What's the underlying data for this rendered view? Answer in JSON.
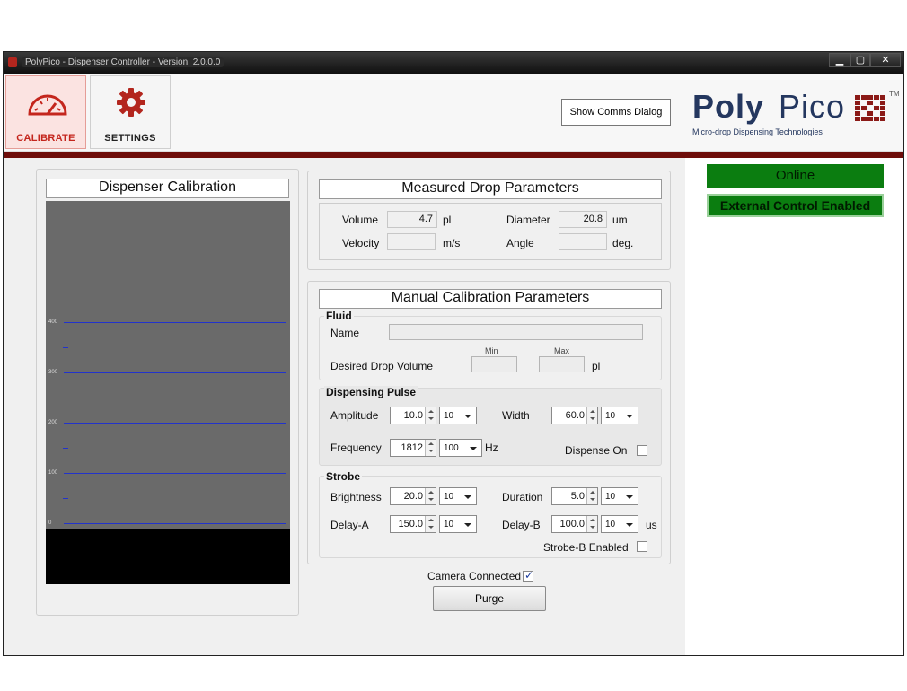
{
  "window": {
    "title": "PolyPico - Dispenser Controller - Version: 2.0.0.0",
    "min": "▁",
    "max": "▢",
    "close": "✕"
  },
  "nav": {
    "calibrate": "CALIBRATE",
    "settings": "SETTINGS",
    "calibrate_icon": "speedometer-icon",
    "settings_icon": "gear-icon"
  },
  "toolbar": {
    "comms_button": "Show Comms Dialog"
  },
  "logo": {
    "poly": "Poly",
    "pico": "Pico",
    "tm": "TM",
    "tagline": "Micro-drop Dispensing Technologies"
  },
  "status": {
    "online": "Online",
    "external": "External Control Enabled",
    "color": "#0b7d10"
  },
  "calibration": {
    "header": "Dispenser Calibration",
    "ticks": [
      "400",
      "300",
      "200",
      "100",
      "0"
    ]
  },
  "measured": {
    "header": "Measured Drop Parameters",
    "volume_label": "Volume",
    "volume_value": "4.7",
    "volume_unit": "pl",
    "diameter_label": "Diameter",
    "diameter_value": "20.8",
    "diameter_unit": "um",
    "velocity_label": "Velocity",
    "velocity_value": "",
    "velocity_unit": "m/s",
    "angle_label": "Angle",
    "angle_value": "",
    "angle_unit": "deg."
  },
  "manual": {
    "header": "Manual Calibration Parameters",
    "fluid": {
      "title": "Fluid",
      "name_label": "Name",
      "name_value": "",
      "desired_label": "Desired Drop Volume",
      "min_label": "Min",
      "max_label": "Max",
      "unit": "pl"
    },
    "pulse": {
      "title": "Dispensing Pulse",
      "amplitude_label": "Amplitude",
      "amplitude_value": "10.0",
      "amplitude_step": "10",
      "width_label": "Width",
      "width_value": "60.0",
      "width_step": "10",
      "frequency_label": "Frequency",
      "frequency_value": "1812",
      "frequency_step": "100",
      "frequency_unit": "Hz",
      "dispense_label": "Dispense On",
      "dispense_checked": false
    },
    "strobe": {
      "title": "Strobe",
      "brightness_label": "Brightness",
      "brightness_value": "20.0",
      "brightness_step": "10",
      "duration_label": "Duration",
      "duration_value": "5.0",
      "duration_step": "10",
      "delaya_label": "Delay-A",
      "delaya_value": "150.0",
      "delaya_step": "10",
      "delayb_label": "Delay-B",
      "delayb_value": "100.0",
      "delayb_step": "10",
      "delayb_unit": "us",
      "strobeb_label": "Strobe-B Enabled",
      "strobeb_checked": false
    }
  },
  "camera": {
    "label": "Camera Connected",
    "checked": true
  },
  "purge": {
    "label": "Purge"
  }
}
